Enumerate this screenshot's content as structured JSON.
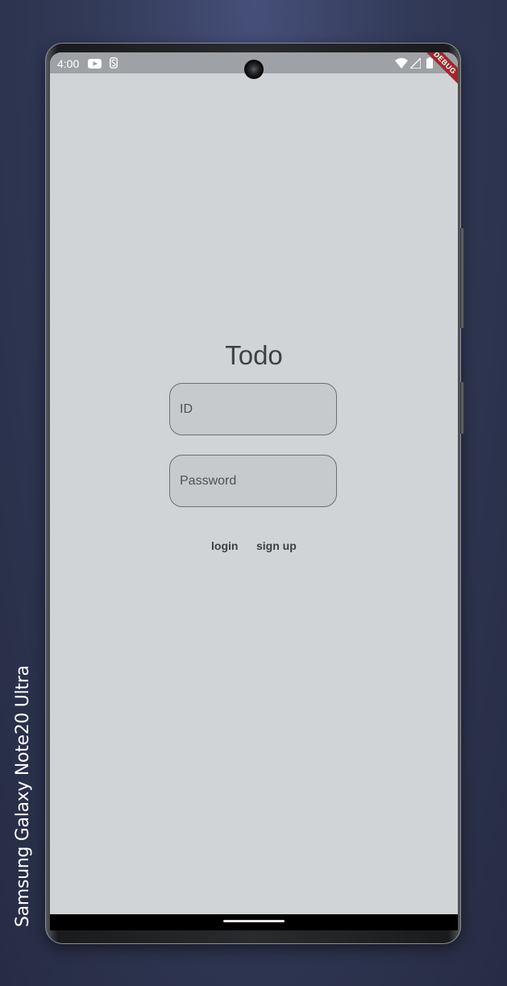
{
  "device": {
    "label": "Samsung Galaxy  Note20 Ultra"
  },
  "status_bar": {
    "time": "4:00",
    "icons": [
      "youtube-icon",
      "s-app-icon",
      "wifi-icon",
      "cellular-signal-icon",
      "battery-icon"
    ]
  },
  "debug_banner": {
    "text": "DEBUG",
    "color": "#a3262e"
  },
  "login": {
    "title": "Todo",
    "id_placeholder": "ID",
    "password_placeholder": "Password",
    "login_label": "login",
    "signup_label": "sign up"
  },
  "colors": {
    "screen_background": "#d1d4d7",
    "field_background": "#c7cacd",
    "text": "#3f4245"
  }
}
